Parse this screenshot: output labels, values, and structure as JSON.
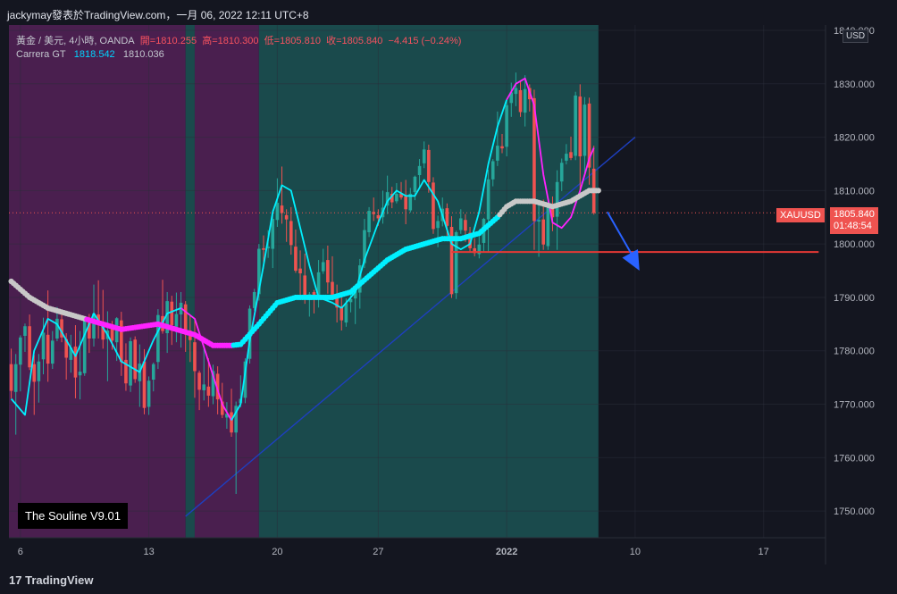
{
  "header": {
    "title": "jackymay發表於TradingView.com，一月 06, 2022 12:11 UTC+8"
  },
  "legend": {
    "symbol": "黃金 / 美元, 4小時, OANDA",
    "open": "開=1810.255",
    "high": "高=1810.300",
    "low": "低=1805.810",
    "close": "收=1805.840",
    "change": "−4.415 (−0.24%)",
    "indicator_name": "Carrera GT",
    "indicator_v1": "1818.542",
    "indicator_v2": "1810.036"
  },
  "watermark": "The Souline V9.01",
  "currency_badge": "USD",
  "price_tag": {
    "symbol": "XAUUSD",
    "price": "1805.840",
    "countdown": "01:48:54"
  },
  "footer": {
    "brand": "TradingView"
  },
  "colors": {
    "background": "#141620",
    "bull": "#26a69a",
    "bear": "#ef5350",
    "purple_zone": "#4a1f4f",
    "teal_zone": "#1a4a4c",
    "cyan": "#00f0ff",
    "magenta": "#ff22ff",
    "trend": "#1e3fbf",
    "support": "#e53935"
  },
  "chart_data": {
    "type": "candlestick",
    "y_ticks": [
      1750,
      1760,
      1770,
      1780,
      1790,
      1800,
      1810,
      1820,
      1830,
      1840
    ],
    "y_tick_labels": [
      "1750.000",
      "1760.000",
      "1770.000",
      "1780.000",
      "1790.000",
      "1800.000",
      "1810.000",
      "1820.000",
      "1830.000",
      "1840.000"
    ],
    "ylim": [
      1745,
      1841
    ],
    "x_ticks": [
      {
        "label": "6",
        "i": 2
      },
      {
        "label": "13",
        "i": 30
      },
      {
        "label": "20",
        "i": 58
      },
      {
        "label": "27",
        "i": 80
      },
      {
        "label": "2022",
        "i": 108
      },
      {
        "label": "10",
        "i": 136
      },
      {
        "label": "17",
        "i": 164
      }
    ],
    "x_count": 178,
    "zones": [
      {
        "from": 0,
        "to": 38.5,
        "type": "bearish"
      },
      {
        "from": 38.5,
        "to": 40.5,
        "type": "bullish"
      },
      {
        "from": 40.5,
        "to": 54.5,
        "type": "bearish"
      },
      {
        "from": 54.5,
        "to": 128.5,
        "type": "bullish"
      }
    ],
    "candles": [
      [
        1777.5,
        1780.4,
        1771.1,
        1772.5
      ],
      [
        1772.3,
        1779.4,
        1764.3,
        1777.5
      ],
      [
        1777.4,
        1782.9,
        1772.4,
        1782.5
      ],
      [
        1782.8,
        1785.1,
        1779.8,
        1784.6
      ],
      [
        1784.6,
        1786.8,
        1776.4,
        1776.9
      ],
      [
        1777.5,
        1779.2,
        1768.0,
        1774.2
      ],
      [
        1774.3,
        1779.4,
        1770.3,
        1778.0
      ],
      [
        1778.4,
        1786.2,
        1775.6,
        1783.4
      ],
      [
        1783.0,
        1791.3,
        1774.2,
        1777.6
      ],
      [
        1777.6,
        1783.7,
        1776.6,
        1781.9
      ],
      [
        1782.3,
        1788.2,
        1781.8,
        1786.0
      ],
      [
        1785.9,
        1787.5,
        1781.6,
        1782.5
      ],
      [
        1782.2,
        1783.3,
        1774.6,
        1778.7
      ],
      [
        1778.3,
        1783.0,
        1775.9,
        1780.6
      ],
      [
        1780.8,
        1784.8,
        1771.1,
        1775.0
      ],
      [
        1775.4,
        1783.7,
        1770.9,
        1776.1
      ],
      [
        1775.8,
        1786.2,
        1775.3,
        1786.0
      ],
      [
        1785.6,
        1786.9,
        1779.6,
        1782.3
      ],
      [
        1782.3,
        1792.4,
        1780.8,
        1787.0
      ],
      [
        1786.8,
        1793.2,
        1782.3,
        1785.1
      ],
      [
        1785.2,
        1791.4,
        1780.4,
        1782.1
      ],
      [
        1782.2,
        1787.4,
        1774.3,
        1783.8
      ],
      [
        1784.1,
        1785.6,
        1780.2,
        1781.9
      ],
      [
        1781.6,
        1786.3,
        1778.1,
        1786.1
      ],
      [
        1785.7,
        1787.3,
        1775.3,
        1777.9
      ],
      [
        1778.3,
        1781.4,
        1772.5,
        1773.9
      ],
      [
        1773.5,
        1782.5,
        1772.3,
        1781.8
      ],
      [
        1782.1,
        1782.7,
        1774.0,
        1774.7
      ],
      [
        1774.3,
        1781.2,
        1769.5,
        1777.6
      ],
      [
        1778.0,
        1780.3,
        1768.1,
        1769.3
      ],
      [
        1769.5,
        1775.2,
        1768.0,
        1774.4
      ],
      [
        1774.6,
        1777.8,
        1772.4,
        1777.5
      ],
      [
        1777.9,
        1787.8,
        1776.6,
        1786.7
      ],
      [
        1786.5,
        1793.3,
        1783.2,
        1783.7
      ],
      [
        1783.3,
        1791.0,
        1779.6,
        1789.3
      ],
      [
        1789.2,
        1790.3,
        1781.1,
        1784.8
      ],
      [
        1784.5,
        1790.9,
        1781.6,
        1786.9
      ],
      [
        1786.8,
        1791.0,
        1780.6,
        1789.0
      ],
      [
        1788.7,
        1789.3,
        1779.8,
        1783.4
      ],
      [
        1783.8,
        1786.5,
        1777.9,
        1782.0
      ],
      [
        1781.6,
        1786.0,
        1771.2,
        1776.2
      ],
      [
        1775.9,
        1776.3,
        1768.9,
        1772.7
      ],
      [
        1772.6,
        1780.4,
        1770.7,
        1773.7
      ],
      [
        1773.3,
        1778.6,
        1769.5,
        1771.6
      ],
      [
        1771.5,
        1777.4,
        1770.0,
        1776.2
      ],
      [
        1775.7,
        1777.1,
        1768.1,
        1770.9
      ],
      [
        1770.5,
        1774.0,
        1767.4,
        1768.0
      ],
      [
        1767.5,
        1770.4,
        1765.4,
        1768.2
      ],
      [
        1768.5,
        1772.9,
        1763.9,
        1764.7
      ],
      [
        1764.7,
        1770.5,
        1753.2,
        1769.7
      ],
      [
        1770.2,
        1775.4,
        1769.4,
        1771.0
      ],
      [
        1771.2,
        1778.6,
        1770.2,
        1778.0
      ],
      [
        1778.5,
        1788.5,
        1777.6,
        1787.9
      ],
      [
        1788.0,
        1791.6,
        1787.5,
        1791.0
      ],
      [
        1790.6,
        1800.0,
        1789.4,
        1799.1
      ],
      [
        1799.2,
        1801.6,
        1795.4,
        1798.9
      ],
      [
        1799.2,
        1802.6,
        1797.4,
        1799.5
      ],
      [
        1799.1,
        1806.4,
        1795.5,
        1804.7
      ],
      [
        1804.5,
        1812.3,
        1803.2,
        1807.7
      ],
      [
        1807.2,
        1814.5,
        1803.8,
        1805.8
      ],
      [
        1805.4,
        1806.5,
        1800.4,
        1804.6
      ],
      [
        1804.3,
        1806.9,
        1798.0,
        1799.8
      ],
      [
        1799.5,
        1802.7,
        1794.6,
        1795.0
      ],
      [
        1795.4,
        1798.8,
        1790.0,
        1794.5
      ],
      [
        1794.1,
        1798.2,
        1788.8,
        1789.7
      ],
      [
        1789.5,
        1791.0,
        1786.4,
        1790.6
      ],
      [
        1791.0,
        1791.4,
        1787.0,
        1789.7
      ],
      [
        1790.0,
        1797.0,
        1788.1,
        1794.7
      ],
      [
        1794.9,
        1799.1,
        1794.4,
        1796.6
      ],
      [
        1797.0,
        1799.7,
        1790.7,
        1792.8
      ],
      [
        1792.9,
        1797.7,
        1789.5,
        1789.8
      ],
      [
        1790.1,
        1792.4,
        1785.3,
        1788.1
      ],
      [
        1788.3,
        1790.6,
        1783.8,
        1785.7
      ],
      [
        1785.3,
        1789.8,
        1784.5,
        1788.9
      ],
      [
        1789.1,
        1791.3,
        1787.2,
        1789.7
      ],
      [
        1789.8,
        1792.4,
        1785.0,
        1791.3
      ],
      [
        1790.9,
        1797.2,
        1787.9,
        1796.0
      ],
      [
        1796.4,
        1804.7,
        1795.5,
        1802.6
      ],
      [
        1802.2,
        1806.9,
        1801.3,
        1806.2
      ],
      [
        1806.0,
        1808.7,
        1804.3,
        1805.6
      ],
      [
        1805.4,
        1806.5,
        1803.4,
        1804.8
      ],
      [
        1805.0,
        1810.0,
        1803.8,
        1806.8
      ],
      [
        1807.2,
        1812.8,
        1805.6,
        1809.7
      ],
      [
        1809.4,
        1810.7,
        1806.7,
        1807.8
      ],
      [
        1808.0,
        1811.4,
        1807.6,
        1809.4
      ],
      [
        1809.4,
        1811.6,
        1808.3,
        1808.7
      ],
      [
        1808.9,
        1812.0,
        1803.7,
        1806.5
      ],
      [
        1806.3,
        1810.5,
        1805.9,
        1809.4
      ],
      [
        1809.7,
        1812.8,
        1808.2,
        1812.6
      ],
      [
        1812.9,
        1815.9,
        1810.4,
        1814.6
      ],
      [
        1815.1,
        1819.2,
        1814.2,
        1817.7
      ],
      [
        1817.6,
        1818.6,
        1809.6,
        1811.6
      ],
      [
        1811.5,
        1812.5,
        1801.9,
        1802.8
      ],
      [
        1803.0,
        1805.3,
        1799.4,
        1804.3
      ],
      [
        1804.3,
        1808.7,
        1803.3,
        1806.6
      ],
      [
        1806.7,
        1807.6,
        1801.5,
        1803.4
      ],
      [
        1803.2,
        1805.2,
        1789.9,
        1790.6
      ],
      [
        1790.8,
        1802.5,
        1789.7,
        1802.2
      ],
      [
        1802.6,
        1806.5,
        1801.9,
        1804.8
      ],
      [
        1804.5,
        1805.6,
        1800.4,
        1802.5
      ],
      [
        1802.1,
        1803.2,
        1798.5,
        1799.2
      ],
      [
        1799.2,
        1801.1,
        1797.7,
        1798.3
      ],
      [
        1798.1,
        1801.8,
        1797.3,
        1799.9
      ],
      [
        1800.2,
        1804.9,
        1798.5,
        1804.7
      ],
      [
        1804.6,
        1813.9,
        1798.4,
        1812.1
      ],
      [
        1812.1,
        1815.9,
        1810.8,
        1815.5
      ],
      [
        1815.6,
        1824.8,
        1814.6,
        1818.4
      ],
      [
        1818.3,
        1820.6,
        1817.0,
        1817.9
      ],
      [
        1818.2,
        1826.8,
        1816.4,
        1826.0
      ],
      [
        1826.4,
        1830.2,
        1823.8,
        1828.4
      ],
      [
        1828.1,
        1832.1,
        1825.8,
        1829.2
      ],
      [
        1828.8,
        1830.5,
        1823.8,
        1824.7
      ],
      [
        1824.6,
        1831.6,
        1822.0,
        1829.0
      ],
      [
        1829.2,
        1829.9,
        1824.8,
        1827.1
      ],
      [
        1827.3,
        1828.9,
        1798.9,
        1804.3
      ],
      [
        1804.2,
        1807.3,
        1797.6,
        1804.5
      ],
      [
        1804.6,
        1808.3,
        1798.9,
        1799.9
      ],
      [
        1799.6,
        1807.3,
        1798.9,
        1806.8
      ],
      [
        1807.2,
        1808.9,
        1802.4,
        1805.0
      ],
      [
        1805.1,
        1813.8,
        1798.9,
        1811.6
      ],
      [
        1811.7,
        1816.0,
        1809.9,
        1815.2
      ],
      [
        1815.6,
        1818.7,
        1814.9,
        1816.9
      ],
      [
        1817.2,
        1820.1,
        1815.7,
        1816.1
      ],
      [
        1816.5,
        1828.5,
        1815.7,
        1827.8
      ],
      [
        1827.6,
        1829.9,
        1809.7,
        1816.4
      ],
      [
        1816.5,
        1827.5,
        1813.0,
        1826.1
      ],
      [
        1826.3,
        1827.4,
        1811.1,
        1814.3
      ],
      [
        1814.1,
        1818.4,
        1805.5,
        1805.8
      ]
    ],
    "indicator_fast_cyan": [
      [
        0,
        1771
      ],
      [
        3,
        1768
      ],
      [
        5,
        1780
      ],
      [
        8,
        1786
      ],
      [
        10,
        1785
      ],
      [
        14,
        1779
      ],
      [
        16,
        1783
      ],
      [
        18,
        1787
      ],
      [
        21,
        1783
      ],
      [
        24,
        1778
      ],
      [
        28,
        1776
      ],
      [
        31,
        1782
      ],
      [
        34,
        1787
      ],
      [
        37,
        1788
      ]
    ],
    "indicator_fast_magenta": [
      [
        37,
        1788
      ],
      [
        40,
        1786
      ],
      [
        43,
        1778
      ],
      [
        46,
        1770
      ],
      [
        48,
        1767
      ]
    ],
    "indicator_fast_cyan_2": [
      [
        48,
        1767
      ],
      [
        50,
        1770
      ],
      [
        52,
        1782
      ],
      [
        55,
        1796
      ],
      [
        57,
        1806
      ],
      [
        59,
        1811
      ],
      [
        61,
        1810
      ],
      [
        63,
        1803
      ],
      [
        65,
        1796
      ],
      [
        67,
        1790
      ],
      [
        70,
        1789
      ],
      [
        72,
        1788
      ]
    ],
    "indicator_fast_cyan_3": [
      [
        72,
        1788
      ],
      [
        75,
        1791
      ],
      [
        77,
        1797
      ],
      [
        80,
        1804
      ],
      [
        82,
        1808
      ],
      [
        84,
        1810
      ],
      [
        86,
        1809
      ],
      [
        88,
        1809
      ],
      [
        90,
        1812
      ],
      [
        93,
        1808
      ],
      [
        96,
        1800
      ],
      [
        98,
        1799
      ],
      [
        100,
        1800
      ],
      [
        102,
        1806
      ],
      [
        104,
        1815
      ],
      [
        106,
        1822
      ],
      [
        108,
        1827
      ]
    ],
    "indicator_fast_magenta_2": [
      [
        108,
        1827
      ],
      [
        110,
        1830
      ],
      [
        112,
        1831
      ],
      [
        114,
        1826
      ],
      [
        116,
        1813
      ],
      [
        118,
        1804
      ],
      [
        120,
        1803
      ],
      [
        122,
        1805
      ],
      [
        124,
        1810
      ],
      [
        126,
        1816
      ],
      [
        127,
        1818
      ]
    ],
    "indicator_slow": [
      [
        0,
        1793
      ],
      [
        4,
        1790
      ],
      [
        8,
        1788
      ],
      [
        12,
        1787
      ],
      [
        16,
        1786
      ],
      [
        20,
        1785
      ],
      [
        24,
        1784
      ],
      [
        28,
        1784.5
      ],
      [
        32,
        1785
      ],
      [
        36,
        1784
      ],
      [
        40,
        1783
      ],
      [
        44,
        1781
      ],
      [
        48,
        1781
      ],
      [
        50,
        1781.2
      ],
      [
        54,
        1785
      ],
      [
        58,
        1789
      ],
      [
        62,
        1790
      ],
      [
        66,
        1790
      ],
      [
        70,
        1790
      ],
      [
        74,
        1791
      ],
      [
        78,
        1794
      ],
      [
        82,
        1797
      ],
      [
        86,
        1799
      ],
      [
        90,
        1800
      ],
      [
        94,
        1801
      ],
      [
        98,
        1801
      ],
      [
        102,
        1802
      ],
      [
        106,
        1805
      ],
      [
        108,
        1807
      ],
      [
        110,
        1808
      ],
      [
        114,
        1808
      ],
      [
        118,
        1807
      ],
      [
        122,
        1808
      ],
      [
        126,
        1810
      ],
      [
        128,
        1810
      ]
    ],
    "slow_segments": [
      {
        "from": 0,
        "to": 16,
        "color": "grey"
      },
      {
        "from": 16,
        "to": 48,
        "color": "magenta"
      },
      {
        "from": 48,
        "to": 106,
        "color": "cyan"
      },
      {
        "from": 106,
        "to": 128,
        "color": "grey"
      }
    ],
    "trendline": [
      [
        38,
        1749
      ],
      [
        136,
        1820
      ]
    ],
    "support_line": {
      "from": 96,
      "to": 176,
      "y": 1798.5
    },
    "current_price": 1805.84,
    "arrow": {
      "from": [
        128,
        1806
      ],
      "to": [
        135,
        1795
      ]
    }
  }
}
